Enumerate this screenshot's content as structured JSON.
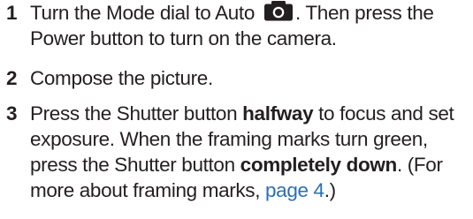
{
  "steps": [
    {
      "number": "1",
      "text_before_icon": "Turn the Mode dial to Auto",
      "icon": "camera-icon",
      "text_after_icon": ". Then press the Power button to turn on the camera."
    },
    {
      "number": "2",
      "text": "Compose the picture."
    },
    {
      "number": "3",
      "text_1": "Press the Shutter button ",
      "bold_1": "halfway",
      "text_2": " to focus and set exposure. When the framing marks turn green, press the Shutter button ",
      "bold_2": "completely down",
      "text_3": ". (For more about framing marks, ",
      "link": "page 4",
      "text_4": ".)"
    }
  ],
  "colors": {
    "text": "#231f20",
    "link": "#2b6fb5"
  }
}
